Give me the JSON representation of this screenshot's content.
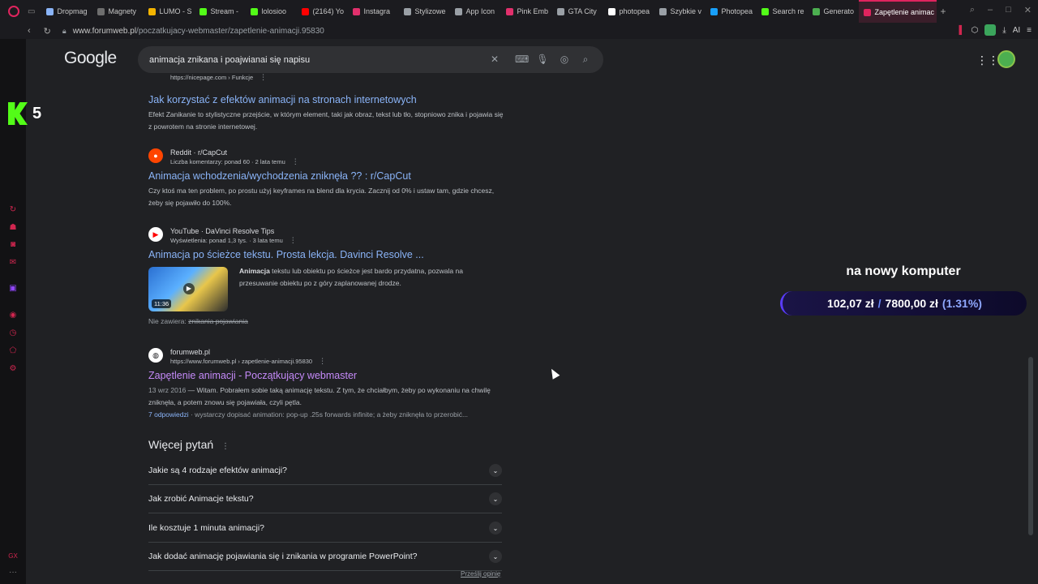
{
  "browser": {
    "tabs": [
      {
        "label": "Dropmag",
        "color": "#8ab4f8"
      },
      {
        "label": "Magnety",
        "color": "#6e6e6e"
      },
      {
        "label": "LUMO - S",
        "color": "#f4b400"
      },
      {
        "label": "Stream -",
        "color": "#53fc18"
      },
      {
        "label": "lolosioo",
        "color": "#53fc18"
      },
      {
        "label": "(2164) Yo",
        "color": "#ff0000"
      },
      {
        "label": "Instagra",
        "color": "#e1306c"
      },
      {
        "label": "Stylizowe",
        "color": "#9aa0a6"
      },
      {
        "label": "App Icon",
        "color": "#9aa0a6"
      },
      {
        "label": "Pink Emb",
        "color": "#e1306c"
      },
      {
        "label": "GTA City",
        "color": "#9aa0a6"
      },
      {
        "label": "photopea",
        "color": "#ffffff"
      },
      {
        "label": "Szybkie v",
        "color": "#9aa0a6"
      },
      {
        "label": "Photopea",
        "color": "#18a0fb"
      },
      {
        "label": "Search re",
        "color": "#53fc18"
      },
      {
        "label": "Generato",
        "color": "#4caf50"
      },
      {
        "label": "Zapętlenie animac",
        "color": "#e0245e"
      }
    ],
    "url_prefix": "www.forumweb.pl",
    "url_path": "/poczatkujacy-webmaster/zapetlenie-animacji.95830",
    "ai_label": "AI"
  },
  "google": {
    "logo": "Google",
    "query": "animacja znikana i poajwianai się napisu"
  },
  "results": [
    {
      "site": "",
      "url": "https://nicepage.com › Funkcje",
      "title": "Jak korzystać z efektów animacji na stronach internetowych",
      "snippet": "Efekt Zanikanie to stylistyczne przejście, w którym element, taki jak obraz, tekst lub tło, stopniowo znika i pojawia się z powrotem na stronie internetowej."
    },
    {
      "site": "Reddit · r/CapCut",
      "url": "Liczba komentarzy: ponad 60 · 2 lata temu",
      "title": "Animacja wchodzenia/wychodzenia zniknęła ?? : r/CapCut",
      "snippet": "Czy ktoś ma ten problem, po prostu użyj keyframes na blend dla krycia. Zacznij od 0% i ustaw tam, gdzie chcesz, żeby się pojawiło do 100%."
    },
    {
      "site": "YouTube · DaVinci Resolve Tips",
      "url": "Wyświetlenia: ponad 1,3 tys. · 3 lata temu",
      "title": "Animacja po ścieżce tekstu. Prosta lekcja. Davinci Resolve ...",
      "snippet_bold": "Animacja",
      "snippet": " tekstu lub obiektu po ścieżce jest bardo przydatna, pozwala na przesuwanie obiektu po z góry zaplanowanej drodze.",
      "duration": "11:36",
      "missing_label": "Nie zawiera:",
      "missing_terms": "znikania pojawiania"
    },
    {
      "site": "forumweb.pl",
      "url": "https://www.forumweb.pl › zapetlenie-animacji.95830",
      "title": "Zapętlenie animacji - Początkujący webmaster",
      "date": "13 wrz 2016",
      "snippet": " — Witam. Pobrałem sobie taką animację tekstu. Z tym, że chciałbym, żeby po wykonaniu na chwilę zniknęła, a potem znowu się pojawiała, czyli pętla.",
      "answers": "7 odpowiedzi",
      "answers_snippet": " · wystarczy dopisać animation: pop-up .25s forwards infinite; a żeby zniknęła to przerobić..."
    }
  ],
  "paa": {
    "heading": "Więcej pytań",
    "items": [
      "Jakie są 4 rodzaje efektów animacji?",
      "Jak zrobić Animacje tekstu?",
      "Ile kosztuje 1 minuta animacji?",
      "Jak dodać animację pojawiania się i znikania w programie PowerPoint?"
    ],
    "feedback": "Prześlij opinię"
  },
  "overlay": {
    "kick_number": "5",
    "goal_title": "na nowy komputer",
    "current": "102,07 zł",
    "separator": "/",
    "target": "7800,00 zł",
    "percent": "(1.31%)",
    "progress_fraction": 0.0131
  }
}
